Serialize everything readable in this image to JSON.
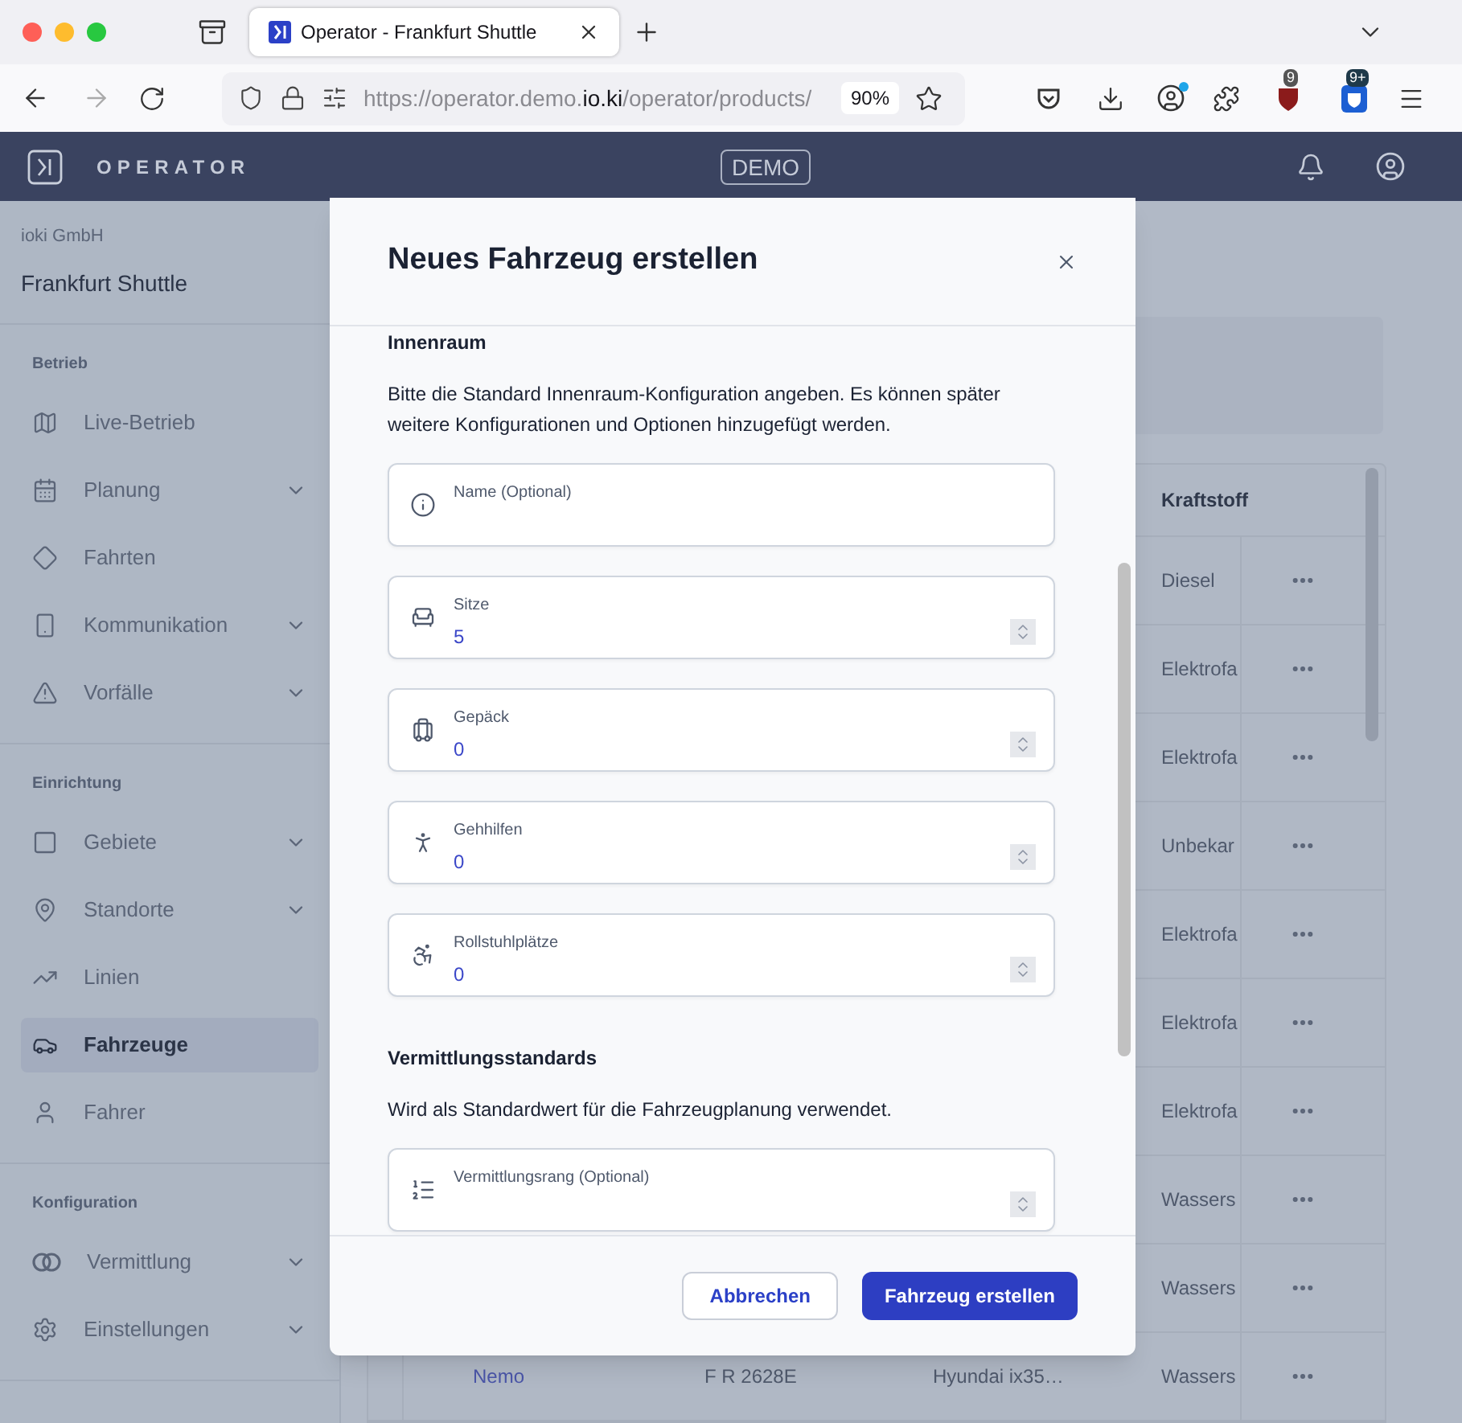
{
  "browser": {
    "tab_title": "Operator - Frankfurt Shuttle",
    "url": {
      "scheme": "https://operator.demo.",
      "domain": "io.ki",
      "path": "/operator/products/"
    },
    "zoom": "90%",
    "extension_badges": [
      "9",
      "9+"
    ]
  },
  "header": {
    "brand": "OPERATOR",
    "environment": "DEMO"
  },
  "sidebar": {
    "organization": "ioki GmbH",
    "product": "Frankfurt Shuttle",
    "sections": [
      {
        "title": "Betrieb",
        "items": [
          {
            "label": "Live-Betrieb",
            "expandable": false,
            "selected": false
          },
          {
            "label": "Planung",
            "expandable": true,
            "selected": false
          },
          {
            "label": "Fahrten",
            "expandable": false,
            "selected": false
          },
          {
            "label": "Kommunikation",
            "expandable": true,
            "selected": false
          },
          {
            "label": "Vorfälle",
            "expandable": true,
            "selected": false
          }
        ]
      },
      {
        "title": "Einrichtung",
        "items": [
          {
            "label": "Gebiete",
            "expandable": true,
            "selected": false
          },
          {
            "label": "Standorte",
            "expandable": true,
            "selected": false
          },
          {
            "label": "Linien",
            "expandable": false,
            "selected": false
          },
          {
            "label": "Fahrzeuge",
            "expandable": false,
            "selected": true
          },
          {
            "label": "Fahrer",
            "expandable": false,
            "selected": false
          }
        ]
      },
      {
        "title": "Konfiguration",
        "items": [
          {
            "label": "Vermittlung",
            "expandable": true,
            "selected": false
          },
          {
            "label": "Einstellungen",
            "expandable": true,
            "selected": false
          }
        ]
      }
    ]
  },
  "table": {
    "columns": [
      "Kraftstoff"
    ],
    "rows": [
      {
        "fuel": "Diesel"
      },
      {
        "fuel": "Elektrofa"
      },
      {
        "fuel": "Elektrofa"
      },
      {
        "fuel": "Unbekar"
      },
      {
        "fuel": "Elektrofa"
      },
      {
        "fuel": "Elektrofa"
      },
      {
        "fuel": "Elektrofa"
      },
      {
        "fuel": "Wassers"
      },
      {
        "fuel": "Wassers"
      },
      {
        "name": "Nemo",
        "plate": "F R 2628E",
        "model": "Hyundai ix35…",
        "fuel": "Wassers"
      }
    ]
  },
  "modal": {
    "title": "Neues Fahrzeug erstellen",
    "sections": [
      {
        "heading": "Innenraum",
        "description": "Bitte die Standard Innenraum-Konfiguration angeben. Es können später weitere Konfigurationen und Optionen hinzugefügt werden.",
        "fields": [
          {
            "kind": "text",
            "label": "Name (Optional)"
          },
          {
            "kind": "number",
            "label": "Sitze",
            "value": "5"
          },
          {
            "kind": "number",
            "label": "Gepäck",
            "value": "0"
          },
          {
            "kind": "number",
            "label": "Gehhilfen",
            "value": "0"
          },
          {
            "kind": "number",
            "label": "Rollstuhlplätze",
            "value": "0"
          }
        ]
      },
      {
        "heading": "Vermittlungsstandards",
        "description": "Wird als Standardwert für die Fahrzeugplanung verwendet.",
        "fields": [
          {
            "kind": "number",
            "label": "Vermittlungsrang (Optional)"
          }
        ]
      }
    ],
    "buttons": {
      "cancel": "Abbrechen",
      "submit": "Fahrzeug erstellen"
    }
  }
}
